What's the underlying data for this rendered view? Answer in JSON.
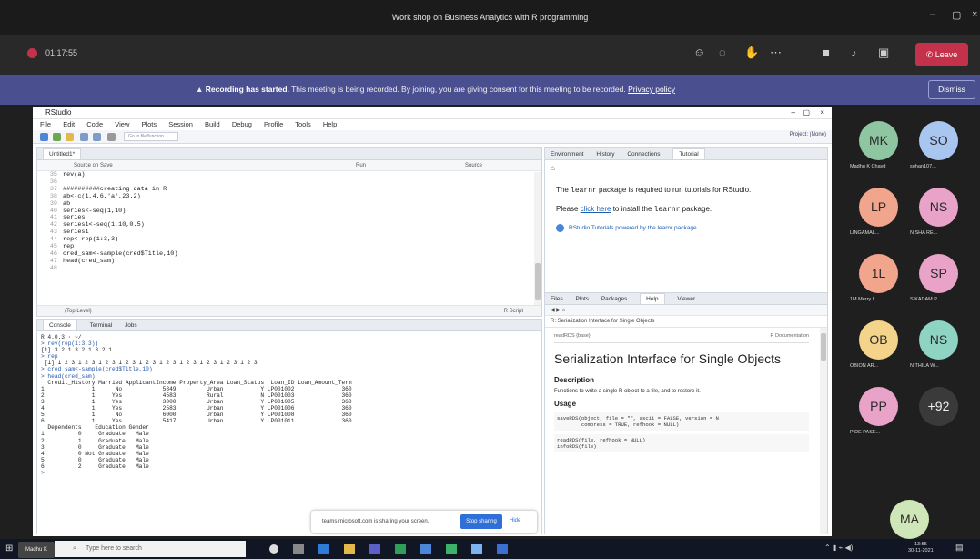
{
  "meeting": {
    "title": "Work shop on Business Analytics with R programming",
    "timer": "01:17:55",
    "leave_label": "Leave"
  },
  "banner": {
    "bold": "Recording has started.",
    "text": " This meeting is being recorded. By joining, you are giving consent for this meeting to be recorded. ",
    "link": "Privacy policy",
    "dismiss_label": "Dismiss"
  },
  "rstudio": {
    "title": "RStudio",
    "menu": [
      "File",
      "Edit",
      "Code",
      "View",
      "Plots",
      "Session",
      "Build",
      "Debug",
      "Profile",
      "Tools",
      "Help"
    ],
    "project": "Project: (None)",
    "editor": {
      "tab": "Untitled1*",
      "source_on_save": "Source on Save",
      "run_label": "Run",
      "source_label": "Source",
      "code_lines": [
        {
          "n": "35",
          "code": "rev(a)"
        },
        {
          "n": "36",
          "code": ""
        },
        {
          "n": "37",
          "code": "##########creating data in R"
        },
        {
          "n": "38",
          "code": "ab<-c(1,4,6,'a',23.2)"
        },
        {
          "n": "39",
          "code": "ab"
        },
        {
          "n": "40",
          "code": "series<-seq(1,10)"
        },
        {
          "n": "41",
          "code": "series"
        },
        {
          "n": "42",
          "code": "series1<-seq(1,10,0.5)"
        },
        {
          "n": "43",
          "code": "series1"
        },
        {
          "n": "44",
          "code": "rep<-rep(1:3,3)"
        },
        {
          "n": "45",
          "code": "rep"
        },
        {
          "n": "46",
          "code": "cred_sam<-sample(cred$Title,10)"
        },
        {
          "n": "47",
          "code": "head(cred_sam)"
        },
        {
          "n": "48",
          "code": ""
        }
      ],
      "status_left": "(Top Level)",
      "status_right": "R Script"
    },
    "console": {
      "tabs": [
        "Console",
        "Terminal",
        "Jobs"
      ],
      "lines": [
        "R 4.0.3 · ~/",
        "> rev(rep(1:3,3))",
        "[1] 3 2 1 3 2 1 3 2 1",
        "> rep",
        " [1] 1 2 3 1 2 3 1 2 3 1 2 3 1 2 3 1 2 3 1 2 3 1 2 3 1 2 3 1 2 3",
        "> cred_sam<-sample(cred$Title,10)",
        "> head(cred_sam)",
        "  Credit_History Married ApplicantIncome Property_Area Loan_Status  Loan_ID Loan_Amount_Term",
        "1              1      No            5849         Urban           Y LP001002              360",
        "2              1     Yes            4583         Rural           N LP001003              360",
        "3              1     Yes            3000         Urban           Y LP001005              360",
        "4              1     Yes            2583         Urban           Y LP001006              360",
        "5              1      No            6000         Urban           Y LP001008              360",
        "6              1     Yes            5417         Urban           Y LP001011              360",
        "  Dependents    Education Gender",
        "1          0     Graduate   Male",
        "2          1     Graduate   Male",
        "3          0     Graduate   Male",
        "4          0 Not Graduate   Male",
        "5          0     Graduate   Male",
        "6          2     Graduate   Male",
        ">"
      ]
    },
    "tutorial": {
      "tabs": [
        "Environment",
        "History",
        "Connections",
        "Tutorial"
      ],
      "line1_pre": "The ",
      "line1_pkg": "learnr",
      "line1_post": " package is required to run tutorials for RStudio.",
      "line2_pre": "Please ",
      "line2_link": "click here",
      "line2_mid": " to install the ",
      "line2_pkg": "learnr",
      "line2_post": " package.",
      "tutorial_link": "RStudio Tutorials powered by the learnr package"
    },
    "help": {
      "tabs": [
        "Files",
        "Plots",
        "Packages",
        "Help",
        "Viewer"
      ],
      "toolbar2": "R: Serialization Interface for Single Objects",
      "topic": "readRDS {base}",
      "doc_label": "R Documentation",
      "title": "Serialization Interface for Single Objects",
      "description_h": "Description",
      "description": "Functions to write a single R object to a file, and to restore it.",
      "usage_h": "Usage",
      "usage1": "saveRDS(object, file = \"\", ascii = FALSE, version = N\n        compress = TRUE, refhook = NULL)",
      "usage2": "readRDS(file, refhook = NULL)\ninfoRDS(file)"
    }
  },
  "participants": [
    {
      "initials": "MK",
      "name": "Madhu K Chavd",
      "color": "#8fc6a2"
    },
    {
      "initials": "SO",
      "name": "sohan107...",
      "color": "#a8c6f0"
    },
    {
      "initials": "LP",
      "name": "LINGAMAL...",
      "color": "#f0a58c"
    },
    {
      "initials": "NS",
      "name": "N SHA RE...",
      "color": "#e9a3c9"
    },
    {
      "initials": "1L",
      "name": "1M Merry L...",
      "color": "#f0a58c"
    },
    {
      "initials": "SP",
      "name": "S KADAM P...",
      "color": "#e9a3c9"
    },
    {
      "initials": "OB",
      "name": "OBION AR...",
      "color": "#f3d48a"
    },
    {
      "initials": "NS",
      "name": "NITHILA W...",
      "color": "#8fd3c2"
    },
    {
      "initials": "PP",
      "name": "P DE PASE...",
      "color": "#e9a3c9"
    },
    {
      "initials": "+92",
      "name": "",
      "color": "#3a3a3a"
    },
    {
      "initials": "MA",
      "name": "",
      "color": "#cfe6b8"
    }
  ],
  "share_notice": {
    "text": "teams.microsoft.com is sharing your screen.",
    "stop_label": "Stop sharing",
    "hide_label": "Hide"
  },
  "taskbar": {
    "search_placeholder": "Type here to search",
    "self_label": "Madhu K Chavd",
    "time": "13:55",
    "date": "30-11-2021"
  }
}
